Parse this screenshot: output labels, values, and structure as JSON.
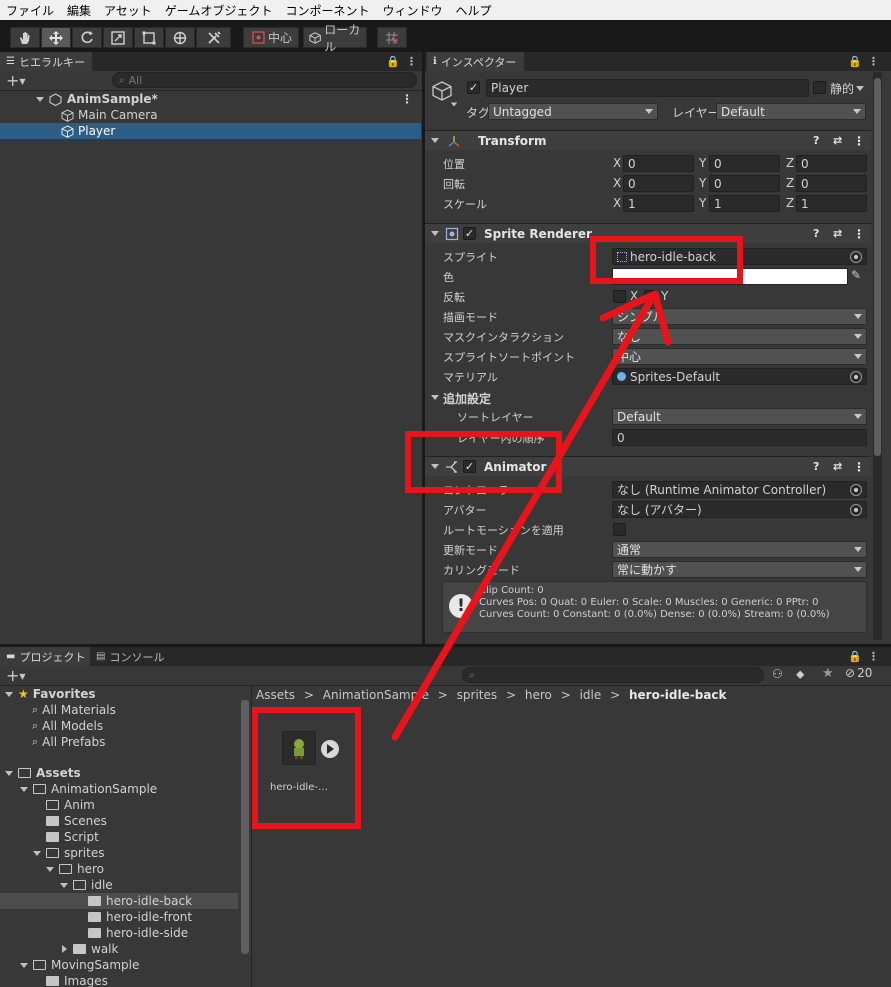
{
  "menu": [
    "ファイル",
    "編集",
    "アセット",
    "ゲームオブジェクト",
    "コンポーネント",
    "ウィンドウ",
    "ヘルプ"
  ],
  "toolbar": {
    "pivot_label": "中心",
    "space_label": "ローカル"
  },
  "hierarchy": {
    "tab": "ヒエラルキー",
    "search_placeholder": "All",
    "scene": "AnimSample*",
    "items": [
      "Main Camera",
      "Player"
    ]
  },
  "inspector": {
    "tab": "インスペクター",
    "object_name": "Player",
    "static_label": "静的",
    "tag_label": "タグ",
    "tag_value": "Untagged",
    "layer_label": "レイヤー",
    "layer_value": "Default",
    "transform": {
      "title": "Transform",
      "position_label": "位置",
      "rotation_label": "回転",
      "scale_label": "スケール",
      "axis": [
        "X",
        "Y",
        "Z"
      ],
      "position": [
        "0",
        "0",
        "0"
      ],
      "rotation": [
        "0",
        "0",
        "0"
      ],
      "scale": [
        "1",
        "1",
        "1"
      ]
    },
    "sprite_renderer": {
      "title": "Sprite Renderer",
      "sprite_label": "スプライト",
      "sprite_value": "hero-idle-back",
      "color_label": "色",
      "flip_label": "反転",
      "flip_x": "X",
      "flip_y": "Y",
      "draw_mode_label": "描画モード",
      "draw_mode_value": "シンプル",
      "mask_label": "マスクインタラクション",
      "mask_value": "なし",
      "sort_point_label": "スプライトソートポイント",
      "sort_point_value": "中心",
      "material_label": "マテリアル",
      "material_value": "Sprites-Default",
      "additional_label": "追加設定",
      "sorting_layer_label": "ソートレイヤー",
      "sorting_layer_value": "Default",
      "order_label": "レイヤー内の順序",
      "order_value": "0"
    },
    "animator": {
      "title": "Animator",
      "controller_label": "コントローラー",
      "controller_value": "なし (Runtime Animator Controller)",
      "avatar_label": "アバター",
      "avatar_value": "なし (アバター)",
      "root_motion_label": "ルートモーションを適用",
      "update_label": "更新モード",
      "update_value": "通常",
      "culling_label": "カリングモード",
      "culling_value": "常に動かす",
      "info": [
        "Clip Count: 0",
        "Curves Pos: 0 Quat: 0 Euler: 0 Scale: 0 Muscles: 0 Generic: 0 PPtr: 0",
        "Curves Count: 0 Constant: 0 (0.0%) Dense: 0 (0.0%) Stream: 0 (0.0%)"
      ]
    }
  },
  "project": {
    "tab_project": "プロジェクト",
    "tab_console": "コンソール",
    "hidden_count": "20",
    "breadcrumb": [
      "Assets",
      "AnimationSample",
      "sprites",
      "hero",
      "idle",
      "hero-idle-back"
    ],
    "asset_name": "hero-idle-…",
    "tree": {
      "favorites": "Favorites",
      "fav_items": [
        "All Materials",
        "All Models",
        "All Prefabs"
      ],
      "assets": "Assets",
      "anim_sample": "AnimationSample",
      "anim": "Anim",
      "scenes": "Scenes",
      "script": "Script",
      "sprites": "sprites",
      "hero": "hero",
      "idle": "idle",
      "idle_children": [
        "hero-idle-back",
        "hero-idle-front",
        "hero-idle-side"
      ],
      "walk": "walk",
      "moving_sample": "MovingSample",
      "images": "Images"
    }
  },
  "colors": {
    "annotation": "#e8141c",
    "selection": "#2c5d87"
  }
}
